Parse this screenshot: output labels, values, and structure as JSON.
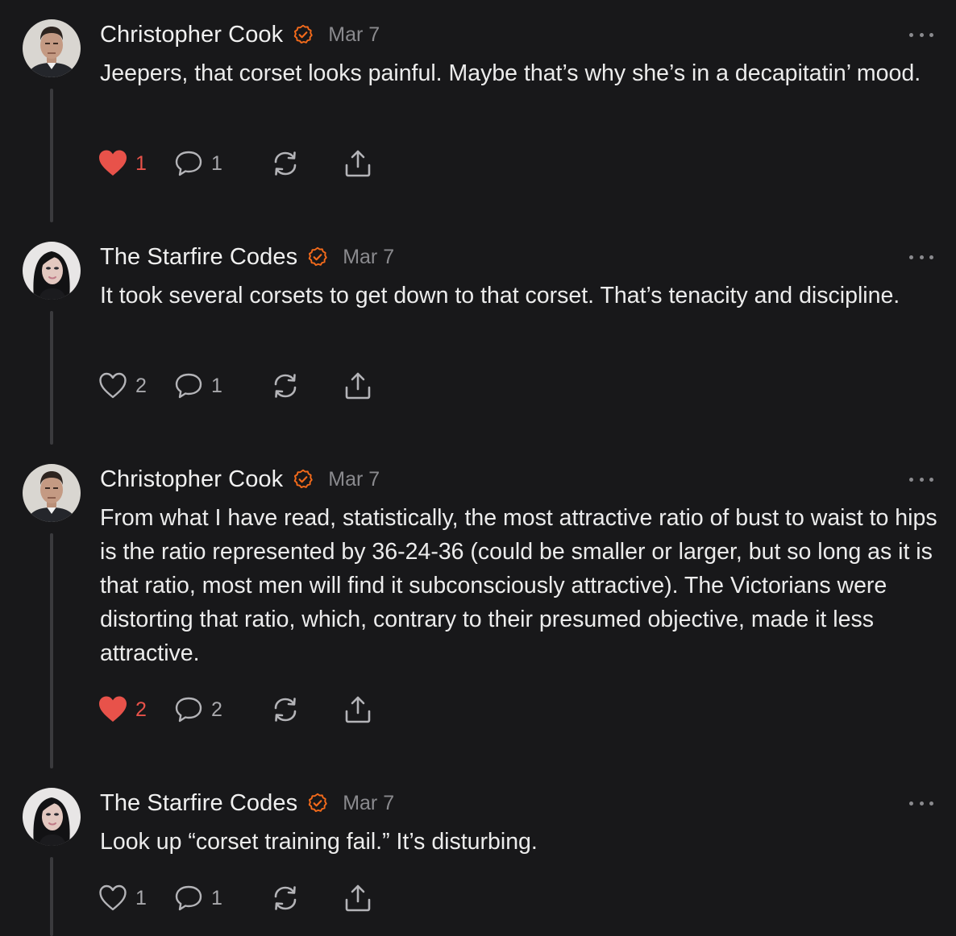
{
  "colors": {
    "background": "#18181a",
    "accent": "#f26a1b",
    "like": "#e8524a",
    "muted": "#8a8a8e"
  },
  "comments": [
    {
      "author": "Christopher Cook",
      "verified_icon": "verified-check-icon",
      "date": "Mar 7",
      "text": "Jeepers, that corset looks painful. Maybe that’s why she’s in a decapitatin’ mood.",
      "likes": "1",
      "liked": true,
      "replies": "1",
      "avatar": "man-portrait"
    },
    {
      "author": "The Starfire Codes",
      "verified_icon": "verified-check-icon",
      "date": "Mar 7",
      "text": "It took several corsets to get down to that corset. That’s tenacity and discipline.",
      "likes": "2",
      "liked": false,
      "replies": "1",
      "avatar": "woman-portrait"
    },
    {
      "author": "Christopher Cook",
      "verified_icon": "verified-check-icon",
      "date": "Mar 7",
      "text": "From what I have read, statistically, the most attractive ratio of bust to waist to hips is the ratio represented by 36-24-36 (could be smaller or larger, but so long as it is that ratio, most men will find it subconsciously attractive). The Victorians were distorting that ratio, which, contrary to their presumed objective, made it less attractive.",
      "likes": "2",
      "liked": true,
      "replies": "2",
      "avatar": "man-portrait"
    },
    {
      "author": "The Starfire Codes",
      "verified_icon": "verified-check-icon",
      "date": "Mar 7",
      "text": "Look up “corset training fail.” It’s disturbing.",
      "likes": "1",
      "liked": false,
      "replies": "1",
      "avatar": "woman-portrait"
    }
  ]
}
